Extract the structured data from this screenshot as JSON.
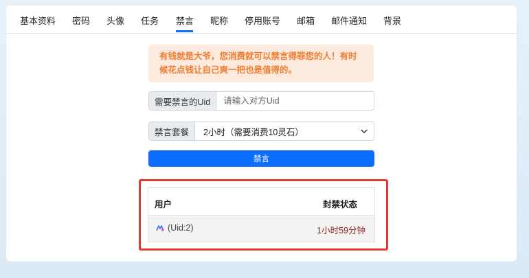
{
  "tabs": [
    {
      "label": "基本资料"
    },
    {
      "label": "密码"
    },
    {
      "label": "头像"
    },
    {
      "label": "任务"
    },
    {
      "label": "禁言",
      "active": true
    },
    {
      "label": "昵称"
    },
    {
      "label": "停用账号"
    },
    {
      "label": "邮箱"
    },
    {
      "label": "邮件通知"
    },
    {
      "label": "背景"
    }
  ],
  "alert": {
    "text": "有钱就是大爷，您消费就可以禁言得罪您的人！有时候花点钱让自己爽一把也是值得的。"
  },
  "uid_field": {
    "label": "需要禁言的Uid",
    "placeholder": "请输入对方Uid",
    "value": ""
  },
  "package_field": {
    "label": "禁言套餐",
    "selected": "2小时（需要消费10灵石）"
  },
  "submit": {
    "label": "禁言"
  },
  "ban_table": {
    "columns": [
      "用户",
      "封禁状态"
    ],
    "rows": [
      {
        "user": "(Uid:2)",
        "status": "1小时59分钟"
      }
    ]
  },
  "colors": {
    "accent": "#0d6efd",
    "alert_bg": "#fdeadf",
    "alert_text": "#ef7d2f",
    "status_text": "#8b1a1a",
    "highlight_border": "#e53a2f"
  }
}
